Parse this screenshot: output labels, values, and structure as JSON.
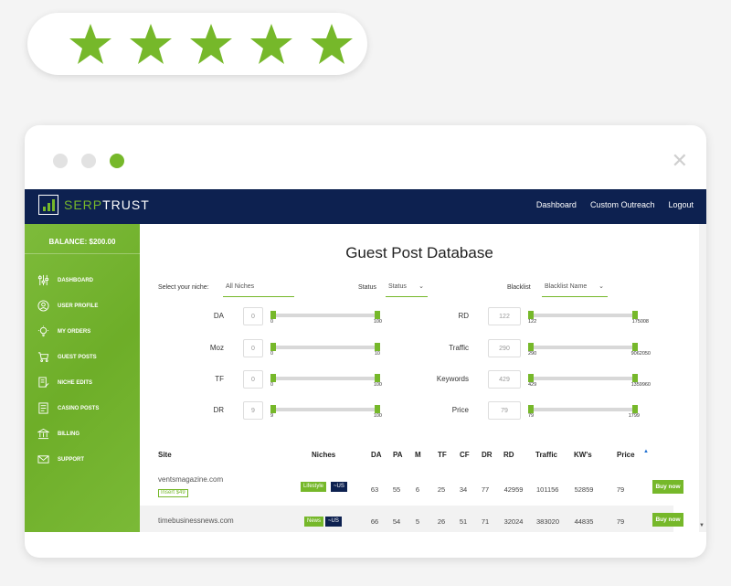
{
  "rating": {
    "stars": 5,
    "color": "#76b82a"
  },
  "window": {
    "dot_colors": [
      "#e2e2e2",
      "#e2e2e2",
      "#76b82a"
    ],
    "close_icon": "close-icon"
  },
  "app": {
    "logo": {
      "part1": "SERP",
      "part2": "TRUST"
    },
    "nav": [
      "Dashboard",
      "Custom Outreach",
      "Logout"
    ],
    "colors": {
      "navy": "#0d2150",
      "green": "#76b82a"
    }
  },
  "sidebar": {
    "balance": "BALANCE: $200.00",
    "items": [
      {
        "label": "DASHBOARD",
        "icon": "sliders-icon"
      },
      {
        "label": "USER PROFILE",
        "icon": "user-icon"
      },
      {
        "label": "MY ORDERS",
        "icon": "lightbulb-icon"
      },
      {
        "label": "GUEST POSTS",
        "icon": "cart-icon"
      },
      {
        "label": "NICHE EDITS",
        "icon": "document-edit-icon"
      },
      {
        "label": "CASINO POSTS",
        "icon": "document-icon"
      },
      {
        "label": "BILLING",
        "icon": "bank-icon"
      },
      {
        "label": "SUPPORT",
        "icon": "mail-icon"
      }
    ]
  },
  "main": {
    "title": "Guest Post Database",
    "niche": {
      "label": "Select your niche:",
      "value": "All Niches"
    },
    "status": {
      "label": "Status",
      "value": "Status"
    },
    "blacklist": {
      "label": "Blacklist",
      "value": "Blacklist Name"
    },
    "filters_left": [
      {
        "label": "DA",
        "value": "0",
        "min": "0",
        "max": "100"
      },
      {
        "label": "Moz",
        "value": "0",
        "min": "0",
        "max": "10"
      },
      {
        "label": "TF",
        "value": "0",
        "min": "0",
        "max": "100"
      },
      {
        "label": "DR",
        "value": "9",
        "min": "9",
        "max": "100"
      }
    ],
    "filters_right": [
      {
        "label": "RD",
        "value": "122",
        "min": "122",
        "max": "175008"
      },
      {
        "label": "Traffic",
        "value": "290",
        "min": "290",
        "max": "9062050"
      },
      {
        "label": "Keywords",
        "value": "429",
        "min": "429",
        "max": "1359960"
      },
      {
        "label": "Price",
        "value": "79",
        "min": "79",
        "max": "1799"
      }
    ],
    "table": {
      "headers": [
        "Site",
        "Niches",
        "DA",
        "PA",
        "M",
        "TF",
        "CF",
        "DR",
        "RD",
        "Traffic",
        "KW's",
        "Price"
      ],
      "sort_icon": "sort-up-icon",
      "rows": [
        {
          "site": "ventsmagazine.com",
          "insert": "Insert $49",
          "niche": "Lifestyle",
          "geo": "~US",
          "da": "63",
          "pa": "55",
          "m": "6",
          "tf": "25",
          "cf": "34",
          "dr": "77",
          "rd": "42959",
          "traffic": "101156",
          "kws": "52859",
          "price": "79",
          "buy": "Buy now"
        },
        {
          "site": "timebusinessnews.com",
          "niche": "News",
          "geo": "~US",
          "da": "66",
          "pa": "54",
          "m": "5",
          "tf": "26",
          "cf": "51",
          "dr": "71",
          "rd": "32024",
          "traffic": "383020",
          "kws": "44835",
          "price": "79",
          "buy": "Buy now"
        }
      ]
    }
  }
}
